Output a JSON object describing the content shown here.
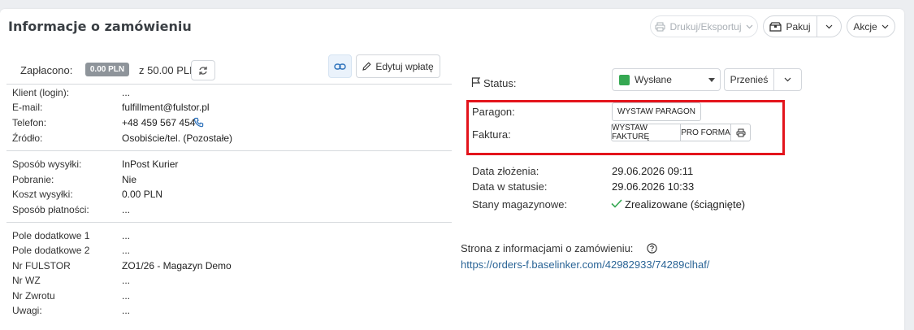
{
  "header": {
    "title": "Informacje o zamówieniu",
    "print_export_label": "Drukuj/Eksportuj",
    "pack_label": "Pakuj",
    "actions_label": "Akcje"
  },
  "payment": {
    "paid_label": "Zapłacono:",
    "paid_amount": "0.00 PLN",
    "total": "z 50.00 PLN",
    "edit_label": "Edytuj wpłatę"
  },
  "client_fields": [
    {
      "label": "Klient (login):",
      "value": "..."
    },
    {
      "label": "E-mail:",
      "value": "fulfillment@fulstor.pl"
    },
    {
      "label": "Telefon:",
      "value": "+48 459 567 454"
    },
    {
      "label": "Źródło:",
      "value": "Osobiście/tel. (Pozostałe)"
    }
  ],
  "shipping_fields": [
    {
      "label": "Sposób wysyłki:",
      "value": "InPost Kurier"
    },
    {
      "label": "Pobranie:",
      "value": "Nie"
    },
    {
      "label": "Koszt wysyłki:",
      "value": "0.00 PLN"
    },
    {
      "label": "Sposób płatności:",
      "value": "..."
    }
  ],
  "extra_fields": [
    {
      "label": "Pole dodatkowe 1",
      "value": "..."
    },
    {
      "label": "Pole dodatkowe 2",
      "value": "..."
    },
    {
      "label": "Nr FULSTOR",
      "value": "ZO1/26 - Magazyn Demo"
    },
    {
      "label": "Nr WZ",
      "value": "..."
    },
    {
      "label": "Nr Zwrotu",
      "value": "..."
    },
    {
      "label": "Uwagi:",
      "value": "..."
    }
  ],
  "status": {
    "label": "Status:",
    "selected": "Wysłane",
    "move_label": "Przenieś",
    "color": "#35a852"
  },
  "documents": {
    "receipt_label": "Paragon:",
    "receipt_button": "WYSTAW PARAGON",
    "invoice_label": "Faktura:",
    "invoice_button": "WYSTAW FAKTURĘ",
    "proforma_button": "PRO FORMA"
  },
  "dates": {
    "created_label": "Data złożenia:",
    "created_value": "29.06.2026 09:11",
    "in_status_label": "Data w statusie:",
    "in_status_value": "29.06.2026 10:33",
    "stock_label": "Stany magazynowe:",
    "stock_value": "Zrealizowane (ściągnięte)"
  },
  "order_page": {
    "heading": "Strona z informacjami o zamówieniu:",
    "url": "https://orders-f.baselinker.com/42982933/74289clhaf/"
  },
  "colors": {
    "highlight": "#e3141c",
    "link": "#2a6496",
    "badge": "#8e949a"
  }
}
